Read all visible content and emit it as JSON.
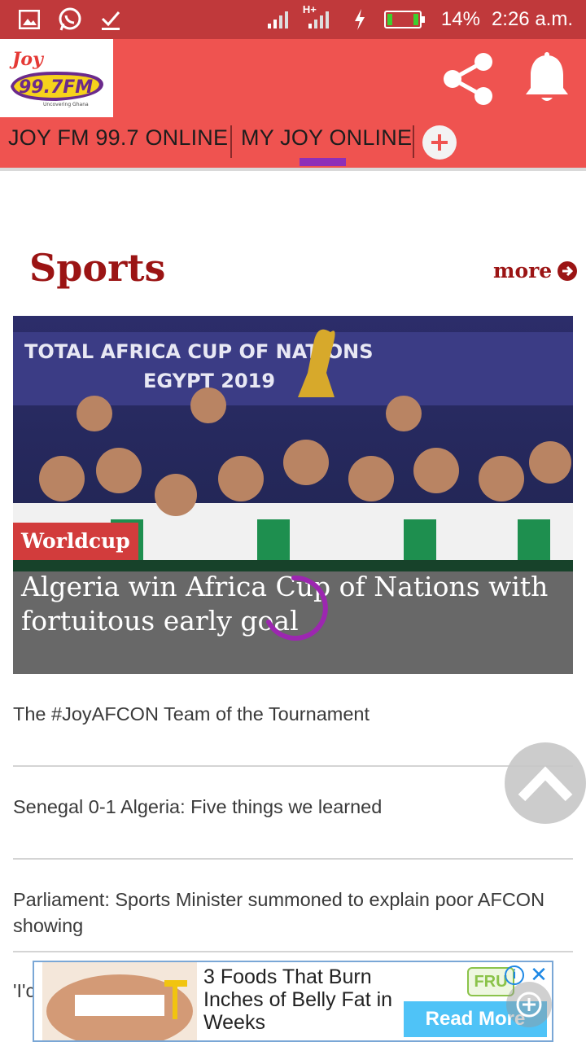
{
  "status_bar": {
    "battery": "14%",
    "time": "2:26 a.m.",
    "network": "H+"
  },
  "header": {
    "logo_text": "JOY 99.7 FM",
    "logo_tagline": "Uncovering Ghana"
  },
  "tabs": {
    "items": [
      {
        "label": "JOY FM 99.7 ONLINE"
      },
      {
        "label": "MY JOY ONLINE"
      }
    ],
    "active_index": 1
  },
  "section": {
    "title": "Sports",
    "more_label": "more"
  },
  "hero": {
    "tag": "Worldcup",
    "title": "Algeria win Africa Cup of Nations with fortuitous early goal",
    "banner_line1": "TOTAL AFRICA CUP OF NATIONS",
    "banner_line2": "EGYPT 2019"
  },
  "headlines": [
    {
      "title": "The #JoyAFCON Team of the Tournament"
    },
    {
      "title": "Senegal 0-1 Algeria: Five things we learned"
    },
    {
      "title": "Parliament: Sports Minister summoned to explain poor AFCON showing"
    },
    {
      "title": "'I'c"
    }
  ],
  "ad": {
    "text": "3 Foods That Burn Inches of Belly Fat in Weeks",
    "cta": "Read More",
    "brand": "FRU"
  },
  "colors": {
    "status_bar": "#c0393b",
    "header": "#ef5350",
    "accent_purple": "#8e2fb8",
    "section_red": "#9b1414"
  }
}
